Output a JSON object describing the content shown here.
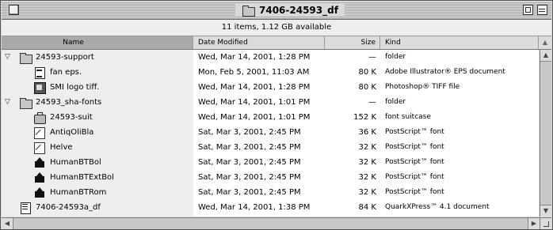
{
  "window": {
    "title": "7406-24593_df",
    "info": "11 items, 1.12 GB available"
  },
  "columns": {
    "name": "Name",
    "date": "Date Modified",
    "size": "Size",
    "kind": "Kind"
  },
  "rows": [
    {
      "name": "24593-support",
      "date": "Wed, Mar 14, 2001, 1:28 PM",
      "size": "—",
      "kind": "folder",
      "icon": "folder-icon",
      "expanded": true,
      "level": 0
    },
    {
      "name": "fan eps.",
      "date": "Mon, Feb 5, 2001, 11:03 AM",
      "size": "80 K",
      "kind": "Adobe Illustrator® EPS document",
      "icon": "document-icon",
      "level": 1
    },
    {
      "name": "SMI logo tiff.",
      "date": "Wed, Mar 14, 2001, 1:28 PM",
      "size": "80 K",
      "kind": "Photoshop® TIFF file",
      "icon": "photoshop-icon",
      "level": 1
    },
    {
      "name": "24593_sha-fonts",
      "date": "Wed, Mar 14, 2001, 1:01 PM",
      "size": "—",
      "kind": "folder",
      "icon": "folder-icon",
      "expanded": true,
      "level": 0
    },
    {
      "name": "24593-suit",
      "date": "Wed, Mar 14, 2001, 1:01 PM",
      "size": "152 K",
      "kind": "font suitcase",
      "icon": "suitcase-icon",
      "level": 1
    },
    {
      "name": "AntiqOliBla",
      "date": "Sat, Mar 3, 2001, 2:45 PM",
      "size": "36 K",
      "kind": "PostScript™ font",
      "icon": "font-icon",
      "level": 1
    },
    {
      "name": "Helve",
      "date": "Sat, Mar 3, 2001, 2:45 PM",
      "size": "32 K",
      "kind": "PostScript™ font",
      "icon": "font-icon",
      "level": 1
    },
    {
      "name": "HumanBTBol",
      "date": "Sat, Mar 3, 2001, 2:45 PM",
      "size": "32 K",
      "kind": "PostScript™ font",
      "icon": "font-black-icon",
      "level": 1
    },
    {
      "name": "HumanBTExtBol",
      "date": "Sat, Mar 3, 2001, 2:45 PM",
      "size": "32 K",
      "kind": "PostScript™ font",
      "icon": "font-black-icon",
      "level": 1
    },
    {
      "name": "HumanBTRom",
      "date": "Sat, Mar 3, 2001, 2:45 PM",
      "size": "32 K",
      "kind": "PostScript™ font",
      "icon": "font-black-icon",
      "level": 1
    },
    {
      "name": "7406-24593a_df",
      "date": "Wed, Mar 14, 2001, 1:38 PM",
      "size": "84 K",
      "kind": "QuarkXPress™ 4.1 document",
      "icon": "quark-document-icon",
      "level": 0
    }
  ],
  "scroll_icons": {
    "up": "▲",
    "down": "▼",
    "left": "◀",
    "right": "▶",
    "sort": "▲",
    "expanded": "▽"
  }
}
